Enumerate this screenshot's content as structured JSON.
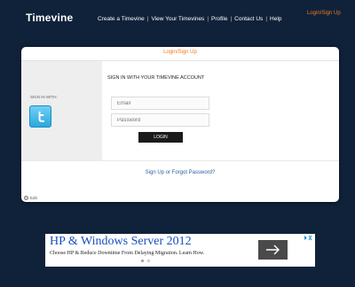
{
  "app": {
    "title": "Timevine"
  },
  "nav": {
    "items": [
      {
        "label": "Create a Timevine"
      },
      {
        "label": "View Your Timevines"
      },
      {
        "label": "Profile"
      },
      {
        "label": "Contact Us"
      },
      {
        "label": "Help"
      }
    ],
    "login_link": "Login/Sign Up"
  },
  "card": {
    "title": "Login/Sign Up",
    "sign_in_with": "SIGN IN WITH:",
    "account_heading": "SIGN IN WITH YOUR TIMEVINE ACCOUNT",
    "email": {
      "placeholder": "Email",
      "value": ""
    },
    "password": {
      "placeholder": "Password",
      "value": ""
    },
    "login_button": "LOGIN",
    "signup_link": "Sign Up or Forgot Password?",
    "edit_label": "Edit"
  },
  "ad": {
    "title": "HP & Windows Server 2012",
    "text": "Choose HP & Reduce Downtime From Delaying Migration. Learn How.",
    "arrow_icon": "arrow-right-icon",
    "choices_icon": "ad-choices-icon"
  },
  "colors": {
    "background": "#10223a",
    "accent": "#f07a1c",
    "link": "#2a5fa0",
    "twitter": "#2aa7df"
  }
}
